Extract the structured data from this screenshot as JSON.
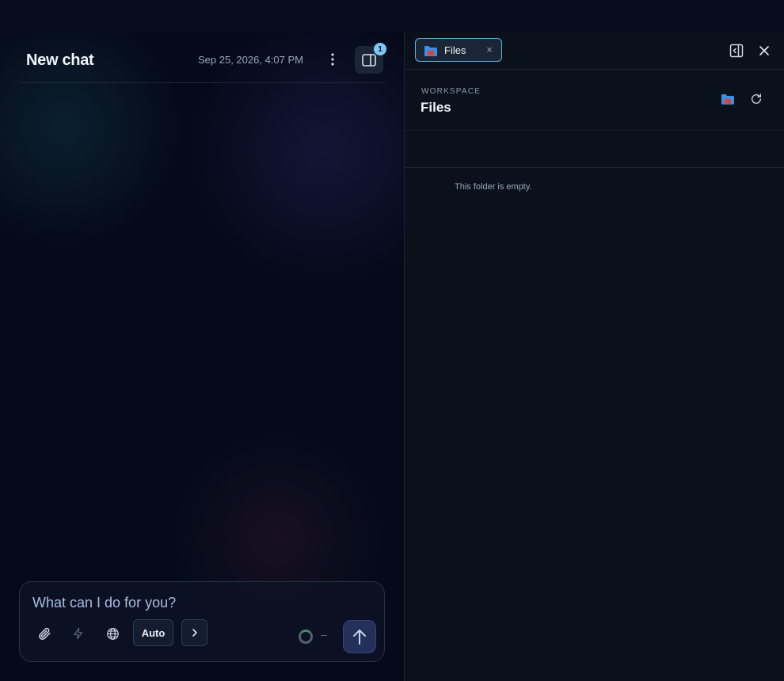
{
  "chat": {
    "title": "New chat",
    "date": "Sep 25, 2026, 4:07 PM",
    "panel_badge": "1",
    "composer": {
      "placeholder": "What can I do for you?",
      "mode_label": "Auto",
      "status_dash": "–"
    }
  },
  "files_panel": {
    "tab_label": "Files",
    "tab_close": "×",
    "section_label": "WORKSPACE",
    "title": "Files",
    "empty_message": "This folder is empty."
  },
  "colors": {
    "accent": "#5fb4ea",
    "badge": "#7cc7f5",
    "send_button": "#24305a",
    "background": "#050a18"
  },
  "icons": [
    "more-vertical-icon",
    "side-panel-icon",
    "paperclip-icon",
    "lightning-icon",
    "globe-icon",
    "chevron-right-icon",
    "arrow-up-icon",
    "folder-icon",
    "collapse-panel-icon",
    "close-icon",
    "refresh-icon"
  ]
}
